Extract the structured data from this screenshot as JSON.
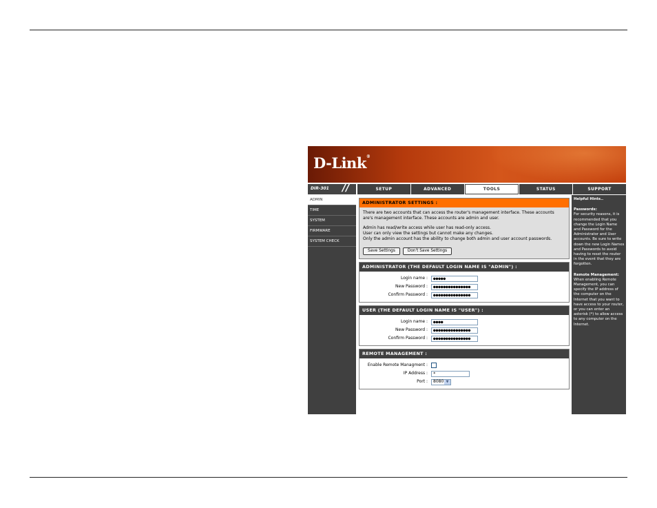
{
  "router": {
    "logo": "D-Link",
    "model": "DIR-301",
    "tabs": [
      "SETUP",
      "ADVANCED",
      "TOOLS",
      "STATUS",
      "SUPPORT"
    ],
    "active_tab": "TOOLS",
    "sidebar": [
      "ADMIN",
      "TIME",
      "SYSTEM",
      "FIRMWARE",
      "SYSTEM CHECK"
    ],
    "active_sidebar": "ADMIN"
  },
  "admin_settings": {
    "title": "ADMINISTRATOR SETTINGS :",
    "intro": "There are two accounts that can access the router's management interface. These accounts are's management interface. These accounts are admin and user.",
    "line1": "Admin has read/write access while user has read-only access.",
    "line2": "User can only view the settings but cannot make any changes.",
    "line3": "Only the admin account has the ability to change both admin and user account passwords.",
    "save_label": "Save Settings",
    "dont_save_label": "Don't Save Settings"
  },
  "administrator": {
    "title": "ADMINISTRATOR (THE DEFAULT LOGIN NAME IS \"ADMIN\") :",
    "login_label": "Login name :",
    "login_value": "●●●●●",
    "new_pw_label": "New Password :",
    "new_pw_value": "●●●●●●●●●●●●●●●",
    "confirm_pw_label": "Confirm Password :",
    "confirm_pw_value": "●●●●●●●●●●●●●●●"
  },
  "user": {
    "title": "USER (THE DEFAULT LOGIN NAME IS \"USER\") :",
    "login_label": "Login name :",
    "login_value": "●●●●",
    "new_pw_label": "New Password :",
    "new_pw_value": "●●●●●●●●●●●●●●●",
    "confirm_pw_label": "Confirm Password :",
    "confirm_pw_value": "●●●●●●●●●●●●●●●"
  },
  "remote": {
    "title": "REMOTE MANAGEMENT :",
    "enable_label": "Enable Remote Managment :",
    "ip_label": "IP Address :",
    "ip_value": "*",
    "port_label": "Port :",
    "port_value": "8080"
  },
  "hints": {
    "title": "Helpful Hints..",
    "passwords_head": "Passwords:",
    "passwords_text": "For security reasons, it is recommended that you change the Login Name and Password for the Administrator and User accounts. Be sure to write down the new Login Names and Passwords to avoid having to reset the router in the event that they are forgotten.",
    "remote_head": "Remote Management:",
    "remote_text": "When enabling Remote Management, you can specify the IP address of the computer on the Internet that you want to have access to your router, or you can enter an asterisk (*) to allow access to any computer on the Internet."
  }
}
